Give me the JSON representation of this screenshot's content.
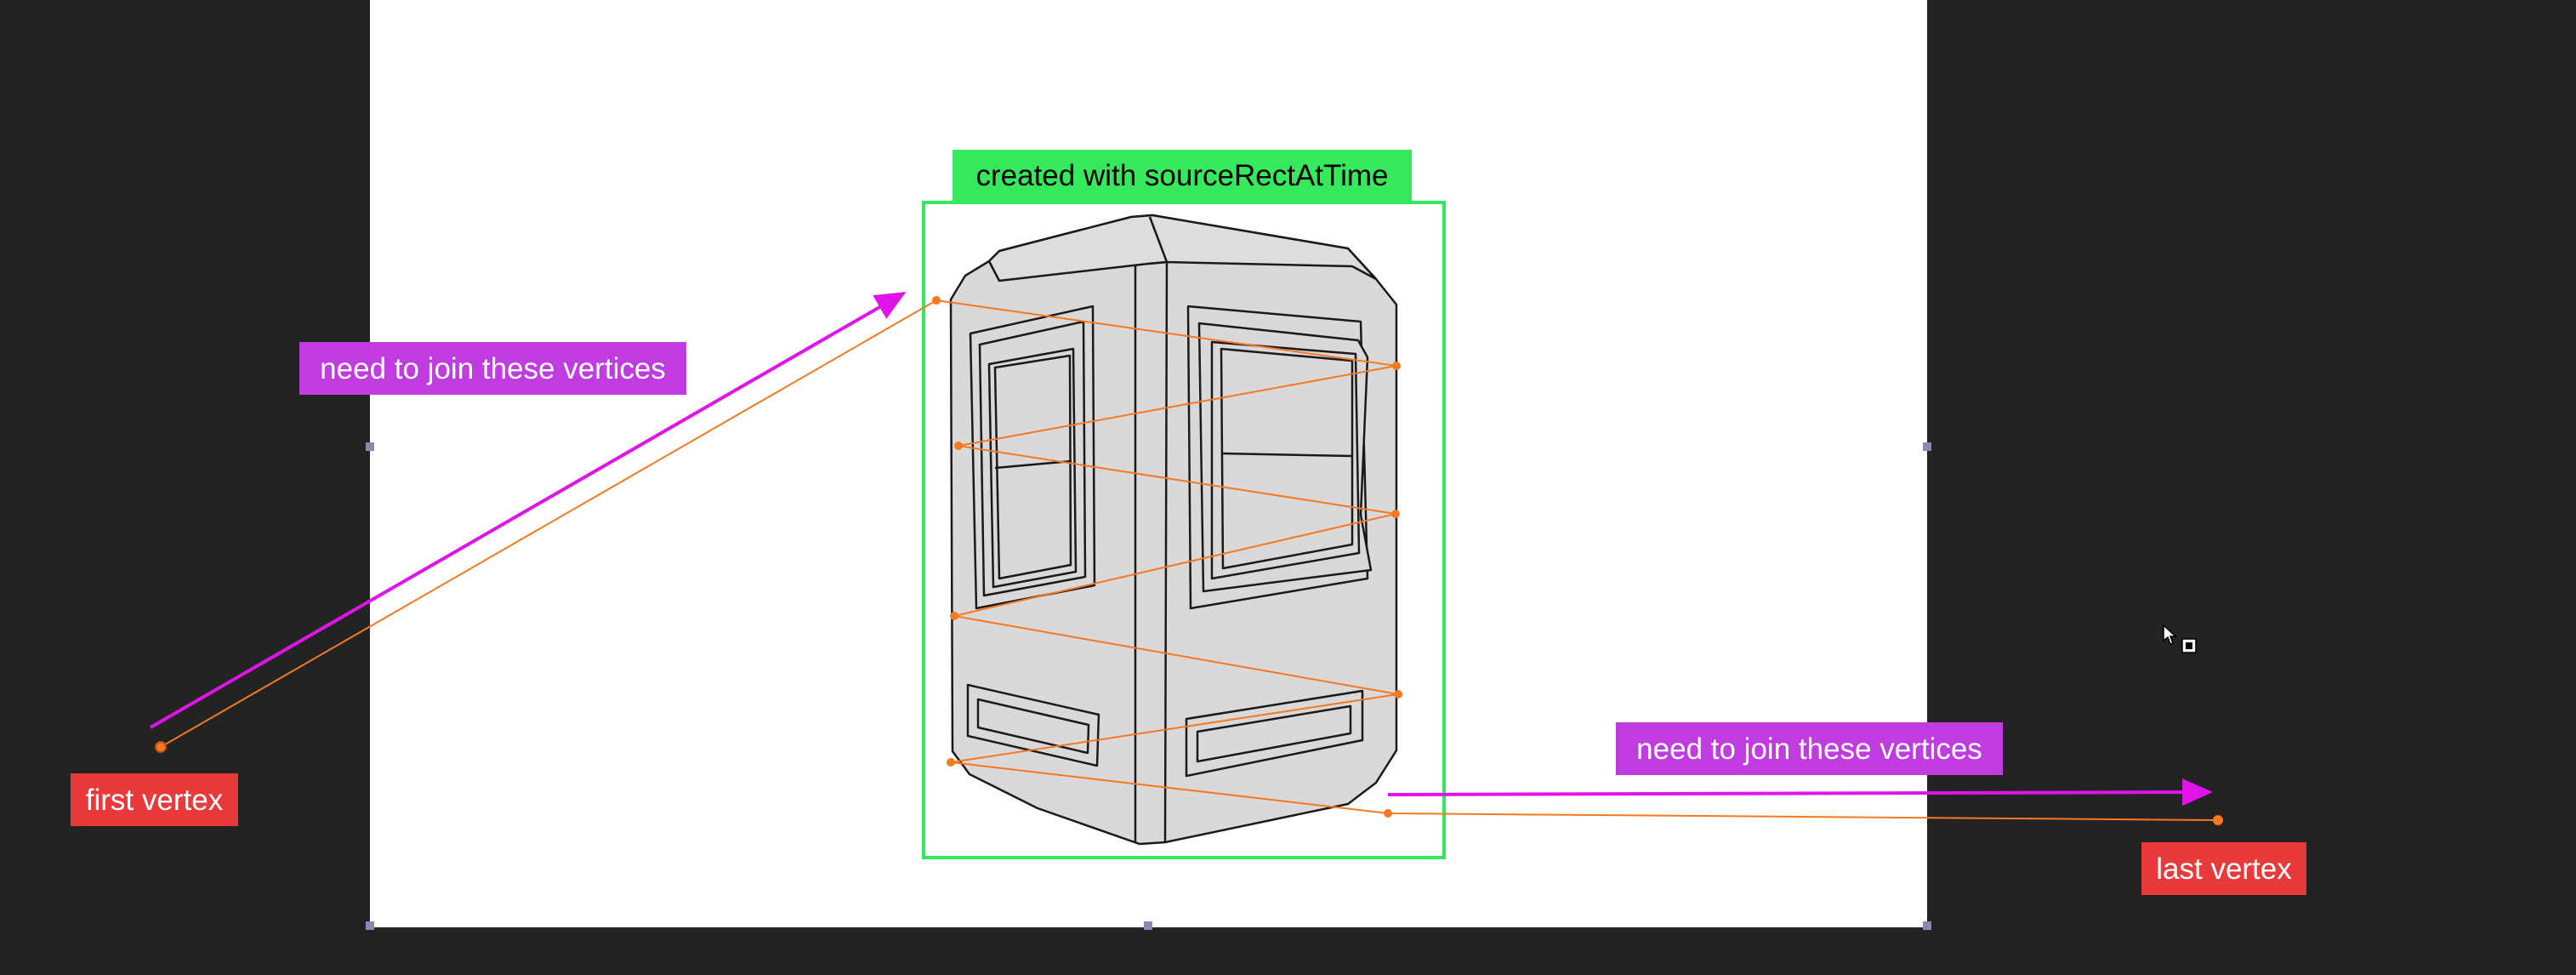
{
  "labels": {
    "source_rect": "created with sourceRectAtTime",
    "join_left": "need to join these vertices",
    "join_right": "need to join these vertices",
    "first_vertex": "first vertex",
    "last_vertex": "last vertex"
  },
  "colors": {
    "green": "#35e85c",
    "magenta_arrow": "#e014e8",
    "magenta_box": "#c03ce0",
    "red": "#e83a3a",
    "orange": "#f47a22",
    "booth_fill": "#d9d9d9",
    "dark_background": "#232323",
    "handle": "#8a8ab0"
  },
  "icons": {
    "cursor": "pen-tool-cursor-icon",
    "anchor": "anchor-point-icon"
  }
}
